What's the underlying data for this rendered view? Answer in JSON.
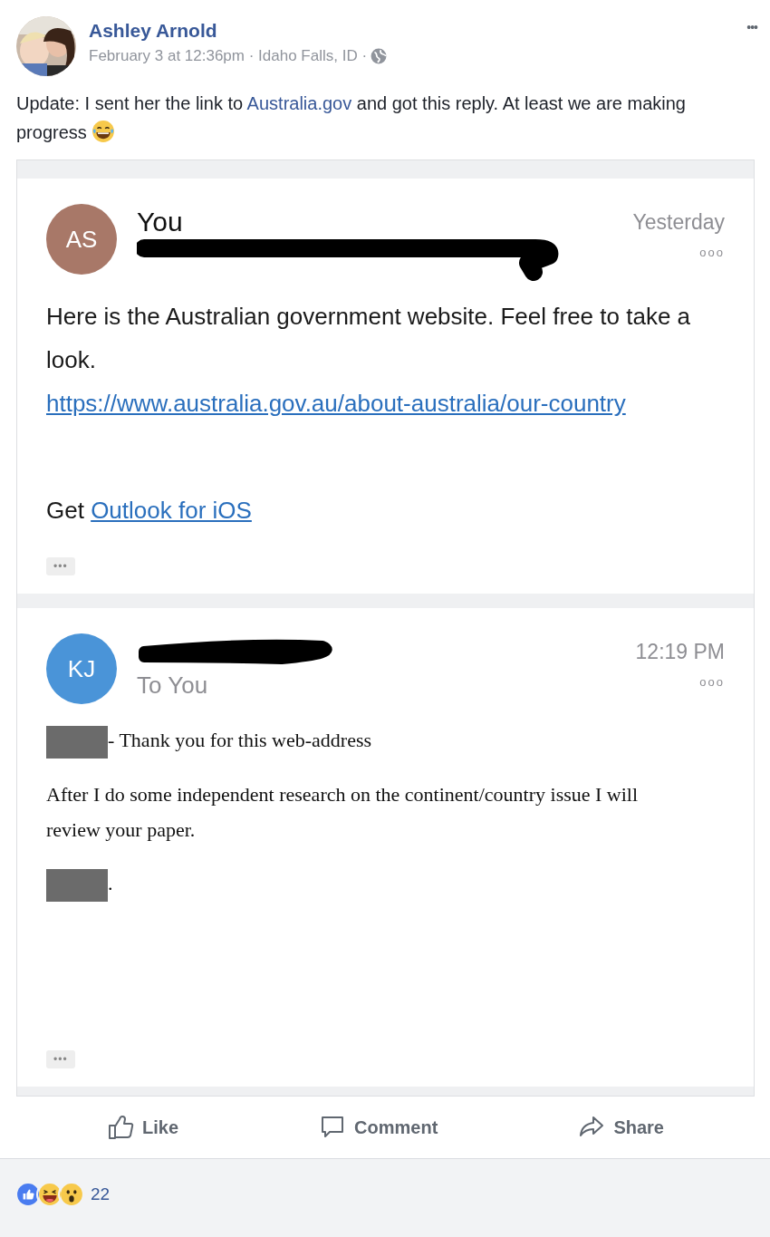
{
  "post": {
    "author": "Ashley Arnold",
    "meta": "February 3 at 12:36pm · Idaho Falls, ID ·",
    "more": "•••",
    "text": [
      {
        "kind": "text",
        "text": "Update: I sent her the link to "
      },
      {
        "kind": "link",
        "text": "Australia.gov"
      },
      {
        "kind": "text",
        "text": " and got this reply. At least we are making progress "
      },
      {
        "kind": "emoji"
      }
    ]
  },
  "emails": [
    {
      "initials": "AS",
      "color": "#a87868",
      "sender": {
        "kind": "text",
        "text": "You"
      },
      "recipient": {
        "kind": "redacted"
      },
      "time": "Yesterday",
      "more": "ooo",
      "body": [
        {
          "kind": "sans",
          "parts": [
            {
              "kind": "text",
              "text": "Here is the Australian government website. Feel free to take a look."
            }
          ]
        },
        {
          "kind": "sans",
          "parts": [
            {
              "kind": "link",
              "text": "https://www.australia.gov.au/about-australia/our-country"
            }
          ]
        },
        {
          "kind": "spacer"
        },
        {
          "kind": "sans",
          "parts": [
            {
              "kind": "text",
              "text": "Get "
            },
            {
              "kind": "link",
              "text": "Outlook for iOS"
            }
          ]
        }
      ],
      "collapsed": "•••"
    },
    {
      "initials": "KJ",
      "color": "#4a94d8",
      "sender": {
        "kind": "redacted"
      },
      "recipient": {
        "kind": "text",
        "text": "To You"
      },
      "time": "12:19 PM",
      "more": "ooo",
      "body": [
        {
          "kind": "serif",
          "parts": [
            {
              "kind": "redaction"
            },
            {
              "kind": "text",
              "text": "- Thank you for this web-address"
            }
          ]
        },
        {
          "kind": "serif",
          "parts": [
            {
              "kind": "text",
              "text": "After I do some independent research on the continent/country issue I will review your paper."
            }
          ]
        },
        {
          "kind": "serif",
          "parts": [
            {
              "kind": "redaction"
            },
            {
              "kind": "text",
              "text": "."
            }
          ]
        }
      ],
      "collapsed": "•••"
    }
  ],
  "actions": [
    {
      "kind": "like",
      "label": "Like"
    },
    {
      "kind": "comment",
      "label": "Comment"
    },
    {
      "kind": "share",
      "label": "Share"
    }
  ],
  "reactions": {
    "icons": [
      {
        "kind": "like"
      },
      {
        "kind": "haha"
      },
      {
        "kind": "wow"
      }
    ],
    "count": "22"
  }
}
